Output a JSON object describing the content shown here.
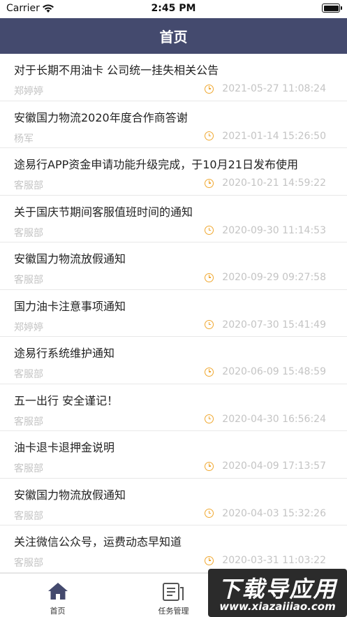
{
  "status_bar": {
    "carrier": "Carrier",
    "time": "2:45 PM"
  },
  "nav": {
    "title": "首页"
  },
  "notices": [
    {
      "title": "对于长期不用油卡 公司统一挂失相关公告",
      "author": "郑婷婷",
      "time": "2021-05-27 11:08:24"
    },
    {
      "title": "安徽国力物流2020年度合作商答谢",
      "author": "杨军",
      "time": "2021-01-14 15:26:50"
    },
    {
      "title": "途易行APP资金申请功能升级完成，于10月21日发布使用",
      "author": "客服部",
      "time": "2020-10-21 14:59:22"
    },
    {
      "title": "关于国庆节期间客服值班时间的通知",
      "author": "客服部",
      "time": "2020-09-30 11:14:53"
    },
    {
      "title": "安徽国力物流放假通知",
      "author": "客服部",
      "time": "2020-09-29 09:27:58"
    },
    {
      "title": "国力油卡注意事项通知",
      "author": "郑婷婷",
      "time": "2020-07-30 15:41:49"
    },
    {
      "title": "途易行系统维护通知",
      "author": "客服部",
      "time": "2020-06-09 15:48:59"
    },
    {
      "title": "五一出行 安全谨记！",
      "author": "客服部",
      "time": "2020-04-30 16:56:24"
    },
    {
      "title": "油卡退卡退押金说明",
      "author": "客服部",
      "time": "2020-04-09 17:13:57"
    },
    {
      "title": "安徽国力物流放假通知",
      "author": "客服部",
      "time": "2020-04-03 15:32:26"
    },
    {
      "title": "关注微信公众号，运费动态早知道",
      "author": "客服部",
      "time": "2020-03-31 11:03:22"
    }
  ],
  "tabs": [
    {
      "label": "首页",
      "icon": "home-icon",
      "active": true
    },
    {
      "label": "任务管理",
      "icon": "task-icon",
      "active": false
    }
  ],
  "watermark": {
    "top": "下载导应用",
    "bottom": "www.xiazaiiiao.com"
  },
  "colors": {
    "nav_bg": "#444a6e",
    "accent_clock": "#f0a830",
    "muted_text": "#c4c4c4",
    "active_tab_icon": "#444a6e",
    "inactive_tab_icon": "#555555"
  }
}
